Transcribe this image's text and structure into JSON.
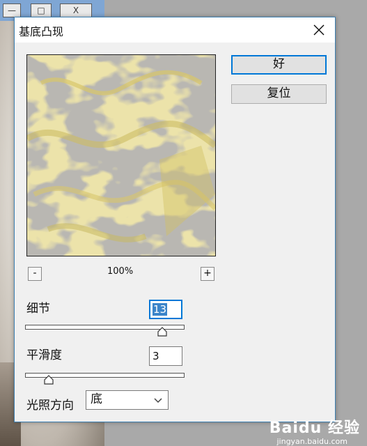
{
  "dialog": {
    "title": "基底凸现",
    "ok_label": "好",
    "reset_label": "复位",
    "zoom": {
      "minus_label": "-",
      "plus_label": "+",
      "level": "100%"
    },
    "detail": {
      "label": "细节",
      "value": "13",
      "slider_fraction": 0.86
    },
    "smoothness": {
      "label": "平滑度",
      "value": "3",
      "slider_fraction": 0.15
    },
    "light_direction": {
      "label": "光照方向",
      "selected": "底"
    }
  },
  "background_window": {
    "controls": [
      "—",
      "□",
      "X"
    ]
  },
  "watermark": {
    "text": "Baidu 经验",
    "sub": "jingyan.baidu.com"
  },
  "colors": {
    "accent": "#0078d7",
    "preview_yellow": "#d6c466",
    "preview_gray": "#b8b6b1"
  }
}
